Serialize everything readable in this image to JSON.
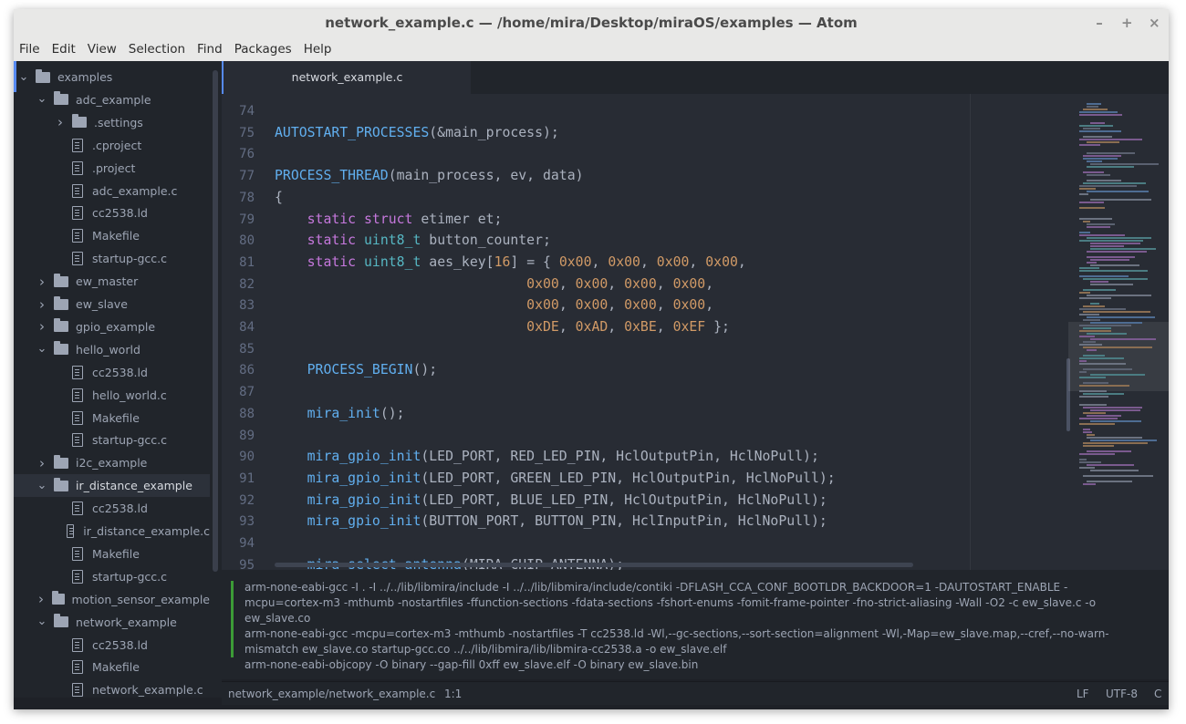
{
  "window": {
    "title": "network_example.c — /home/mira/Desktop/miraOS/examples — Atom",
    "controls": [
      "–",
      "+",
      "×"
    ]
  },
  "menu": [
    "File",
    "Edit",
    "View",
    "Selection",
    "Find",
    "Packages",
    "Help"
  ],
  "tree": [
    {
      "label": "examples",
      "type": "folder",
      "depth": 0,
      "expanded": true
    },
    {
      "label": "adc_example",
      "type": "folder",
      "depth": 1,
      "expanded": true
    },
    {
      "label": ".settings",
      "type": "folder",
      "depth": 2,
      "expanded": false
    },
    {
      "label": ".cproject",
      "type": "file",
      "depth": 2
    },
    {
      "label": ".project",
      "type": "file",
      "depth": 2
    },
    {
      "label": "adc_example.c",
      "type": "file",
      "depth": 2
    },
    {
      "label": "cc2538.ld",
      "type": "file",
      "depth": 2
    },
    {
      "label": "Makefile",
      "type": "file",
      "depth": 2
    },
    {
      "label": "startup-gcc.c",
      "type": "file",
      "depth": 2
    },
    {
      "label": "ew_master",
      "type": "folder",
      "depth": 1,
      "expanded": false
    },
    {
      "label": "ew_slave",
      "type": "folder",
      "depth": 1,
      "expanded": false
    },
    {
      "label": "gpio_example",
      "type": "folder",
      "depth": 1,
      "expanded": false
    },
    {
      "label": "hello_world",
      "type": "folder",
      "depth": 1,
      "expanded": true
    },
    {
      "label": "cc2538.ld",
      "type": "file",
      "depth": 2
    },
    {
      "label": "hello_world.c",
      "type": "file",
      "depth": 2
    },
    {
      "label": "Makefile",
      "type": "file",
      "depth": 2
    },
    {
      "label": "startup-gcc.c",
      "type": "file",
      "depth": 2
    },
    {
      "label": "i2c_example",
      "type": "folder",
      "depth": 1,
      "expanded": false
    },
    {
      "label": "ir_distance_example",
      "type": "folder",
      "depth": 1,
      "expanded": true,
      "selected": true
    },
    {
      "label": "cc2538.ld",
      "type": "file",
      "depth": 2
    },
    {
      "label": "ir_distance_example.c",
      "type": "file",
      "depth": 2
    },
    {
      "label": "Makefile",
      "type": "file",
      "depth": 2
    },
    {
      "label": "startup-gcc.c",
      "type": "file",
      "depth": 2
    },
    {
      "label": "motion_sensor_example",
      "type": "folder",
      "depth": 1,
      "expanded": false
    },
    {
      "label": "network_example",
      "type": "folder",
      "depth": 1,
      "expanded": true
    },
    {
      "label": "cc2538.ld",
      "type": "file",
      "depth": 2
    },
    {
      "label": "Makefile",
      "type": "file",
      "depth": 2
    },
    {
      "label": "network_example.c",
      "type": "file",
      "depth": 2
    }
  ],
  "tab": {
    "label": "network_example.c"
  },
  "editor": {
    "lines": [
      {
        "n": "74",
        "tokens": []
      },
      {
        "n": "75",
        "tokens": [
          [
            "fn",
            "AUTOSTART_PROCESSES"
          ],
          [
            "pl",
            "(&main_process);"
          ]
        ]
      },
      {
        "n": "76",
        "tokens": []
      },
      {
        "n": "77",
        "tokens": [
          [
            "fn",
            "PROCESS_THREAD"
          ],
          [
            "pl",
            "(main_process, ev, data)"
          ]
        ]
      },
      {
        "n": "78",
        "tokens": [
          [
            "pl",
            "{"
          ]
        ]
      },
      {
        "n": "79",
        "tokens": [
          [
            "pl",
            "    "
          ],
          [
            "kw",
            "static"
          ],
          [
            "pl",
            " "
          ],
          [
            "kw",
            "struct"
          ],
          [
            "pl",
            " etimer et;"
          ]
        ]
      },
      {
        "n": "80",
        "tokens": [
          [
            "pl",
            "    "
          ],
          [
            "kw",
            "static"
          ],
          [
            "pl",
            " "
          ],
          [
            "ty",
            "uint8_t"
          ],
          [
            "pl",
            " button_counter;"
          ]
        ]
      },
      {
        "n": "81",
        "tokens": [
          [
            "pl",
            "    "
          ],
          [
            "kw",
            "static"
          ],
          [
            "pl",
            " "
          ],
          [
            "ty",
            "uint8_t"
          ],
          [
            "pl",
            " aes_key["
          ],
          [
            "nm",
            "16"
          ],
          [
            "pl",
            "] = { "
          ],
          [
            "nm",
            "0x00"
          ],
          [
            "pl",
            ", "
          ],
          [
            "nm",
            "0x00"
          ],
          [
            "pl",
            ", "
          ],
          [
            "nm",
            "0x00"
          ],
          [
            "pl",
            ", "
          ],
          [
            "nm",
            "0x00"
          ],
          [
            "pl",
            ","
          ]
        ]
      },
      {
        "n": "82",
        "tokens": [
          [
            "pl",
            "                               "
          ],
          [
            "nm",
            "0x00"
          ],
          [
            "pl",
            ", "
          ],
          [
            "nm",
            "0x00"
          ],
          [
            "pl",
            ", "
          ],
          [
            "nm",
            "0x00"
          ],
          [
            "pl",
            ", "
          ],
          [
            "nm",
            "0x00"
          ],
          [
            "pl",
            ","
          ]
        ]
      },
      {
        "n": "83",
        "tokens": [
          [
            "pl",
            "                               "
          ],
          [
            "nm",
            "0x00"
          ],
          [
            "pl",
            ", "
          ],
          [
            "nm",
            "0x00"
          ],
          [
            "pl",
            ", "
          ],
          [
            "nm",
            "0x00"
          ],
          [
            "pl",
            ", "
          ],
          [
            "nm",
            "0x00"
          ],
          [
            "pl",
            ","
          ]
        ]
      },
      {
        "n": "84",
        "tokens": [
          [
            "pl",
            "                               "
          ],
          [
            "nm",
            "0xDE"
          ],
          [
            "pl",
            ", "
          ],
          [
            "nm",
            "0xAD"
          ],
          [
            "pl",
            ", "
          ],
          [
            "nm",
            "0xBE"
          ],
          [
            "pl",
            ", "
          ],
          [
            "nm",
            "0xEF"
          ],
          [
            "pl",
            " };"
          ]
        ]
      },
      {
        "n": "85",
        "tokens": []
      },
      {
        "n": "86",
        "tokens": [
          [
            "pl",
            "    "
          ],
          [
            "fn",
            "PROCESS_BEGIN"
          ],
          [
            "pl",
            "();"
          ]
        ]
      },
      {
        "n": "87",
        "tokens": []
      },
      {
        "n": "88",
        "tokens": [
          [
            "pl",
            "    "
          ],
          [
            "fn",
            "mira_init"
          ],
          [
            "pl",
            "();"
          ]
        ]
      },
      {
        "n": "89",
        "tokens": []
      },
      {
        "n": "90",
        "tokens": [
          [
            "pl",
            "    "
          ],
          [
            "fn",
            "mira_gpio_init"
          ],
          [
            "pl",
            "(LED_PORT, RED_LED_PIN, HclOutputPin, HclNoPull);"
          ]
        ]
      },
      {
        "n": "91",
        "tokens": [
          [
            "pl",
            "    "
          ],
          [
            "fn",
            "mira_gpio_init"
          ],
          [
            "pl",
            "(LED_PORT, GREEN_LED_PIN, HclOutputPin, HclNoPull);"
          ]
        ]
      },
      {
        "n": "92",
        "tokens": [
          [
            "pl",
            "    "
          ],
          [
            "fn",
            "mira_gpio_init"
          ],
          [
            "pl",
            "(LED_PORT, BLUE_LED_PIN, HclOutputPin, HclNoPull);"
          ]
        ]
      },
      {
        "n": "93",
        "tokens": [
          [
            "pl",
            "    "
          ],
          [
            "fn",
            "mira_gpio_init"
          ],
          [
            "pl",
            "(BUTTON_PORT, BUTTON_PIN, HclInputPin, HclNoPull);"
          ]
        ]
      },
      {
        "n": "94",
        "tokens": []
      },
      {
        "n": "95",
        "tokens": [
          [
            "pl",
            "    "
          ],
          [
            "fn",
            "mira_select_antenna"
          ],
          [
            "pl",
            "(MIRA_CHIP_ANTENNA);"
          ]
        ]
      }
    ]
  },
  "console": {
    "lines": [
      "arm-none-eabi-gcc -I . -I ../../lib/libmira/include -I ../../lib/libmira/include/contiki -DFLASH_CCA_CONF_BOOTLDR_BACKDOOR=1 -DAUTOSTART_ENABLE -mcpu=cortex-m3 -mthumb -nostartfiles -ffunction-sections -fdata-sections -fshort-enums -fomit-frame-pointer -fno-strict-aliasing -Wall -O2 -c ew_slave.c -o ew_slave.co",
      "arm-none-eabi-gcc -mcpu=cortex-m3 -mthumb -nostartfiles -T cc2538.ld -Wl,--gc-sections,--sort-section=alignment -Wl,-Map=ew_slave.map,--cref,--no-warn-mismatch ew_slave.co startup-gcc.co ../../lib/libmira/lib/libmira-cc2538.a -o ew_slave.elf",
      "arm-none-eabi-objcopy -O binary --gap-fill 0xff ew_slave.elf -O binary ew_slave.bin"
    ]
  },
  "status": {
    "path": "network_example/network_example.c",
    "cursor": "1:1",
    "line_ending": "LF",
    "encoding": "UTF-8",
    "grammar": "C"
  },
  "colors": {
    "keyword": "#c678dd",
    "function": "#61afef",
    "type": "#56b6c2",
    "number": "#d19a66",
    "text": "#abb2bf",
    "accent": "#568af2",
    "success": "#3c9b36"
  }
}
